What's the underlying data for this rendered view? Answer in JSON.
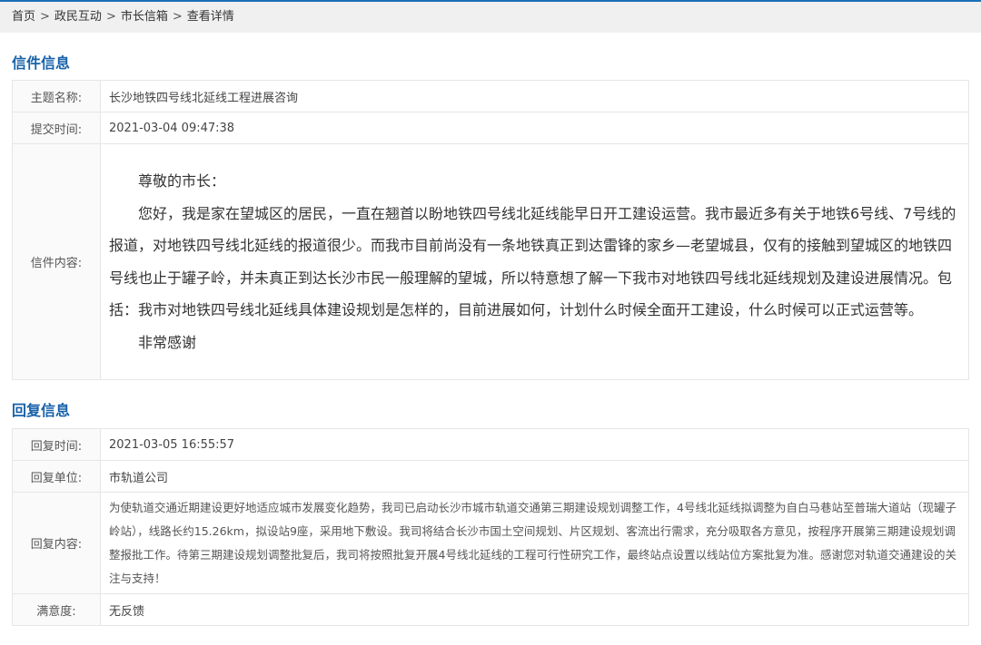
{
  "breadcrumb": {
    "items": [
      "首页",
      "政民互动",
      "市长信箱",
      "查看详情"
    ],
    "separator": ">"
  },
  "letter_section": {
    "title": "信件信息",
    "subject_label": "主题名称:",
    "subject": "长沙地铁四号线北延线工程进展咨询",
    "time_label": "提交时间:",
    "time": "2021-03-04 09:47:38",
    "content_label": "信件内容:",
    "paragraphs": [
      "尊敬的市长：",
      "您好，我是家在望城区的居民，一直在翘首以盼地铁四号线北延线能早日开工建设运营。我市最近多有关于地铁6号线、7号线的报道，对地铁四号线北延线的报道很少。而我市目前尚没有一条地铁真正到达雷锋的家乡—老望城县，仅有的接触到望城区的地铁四号线也止于罐子岭，并未真正到达长沙市民一般理解的望城，所以特意想了解一下我市对地铁四号线北延线规划及建设进展情况。包括：我市对地铁四号线北延线具体建设规划是怎样的，目前进展如何，计划什么时候全面开工建设，什么时候可以正式运营等。",
      "非常感谢"
    ]
  },
  "reply_section": {
    "title": "回复信息",
    "time_label": "回复时间:",
    "time": "2021-03-05 16:55:57",
    "unit_label": "回复单位:",
    "unit": "市轨道公司",
    "content_label": "回复内容:",
    "content": "为使轨道交通近期建设更好地适应城市发展变化趋势，我司已启动长沙市城市轨道交通第三期建设规划调整工作，4号线北延线拟调整为自白马巷站至普瑞大道站（现罐子岭站），线路长约15.26km，拟设站9座，采用地下敷设。我司将结合长沙市国土空间规划、片区规划、客流出行需求，充分吸取各方意见，按程序开展第三期建设规划调整报批工作。待第三期建设规划调整批复后，我司将按照批复开展4号线北延线的工程可行性研究工作，最终站点设置以线站位方案批复为准。感谢您对轨道交通建设的关注与支持！",
    "satisfaction_label": "满意度:",
    "satisfaction": "无反馈"
  },
  "colors": {
    "accent": "#1761a9",
    "topline": "#1c6fb5",
    "breadcrumb_bg": "#f0f0f0",
    "border": "#e6e6e6"
  }
}
